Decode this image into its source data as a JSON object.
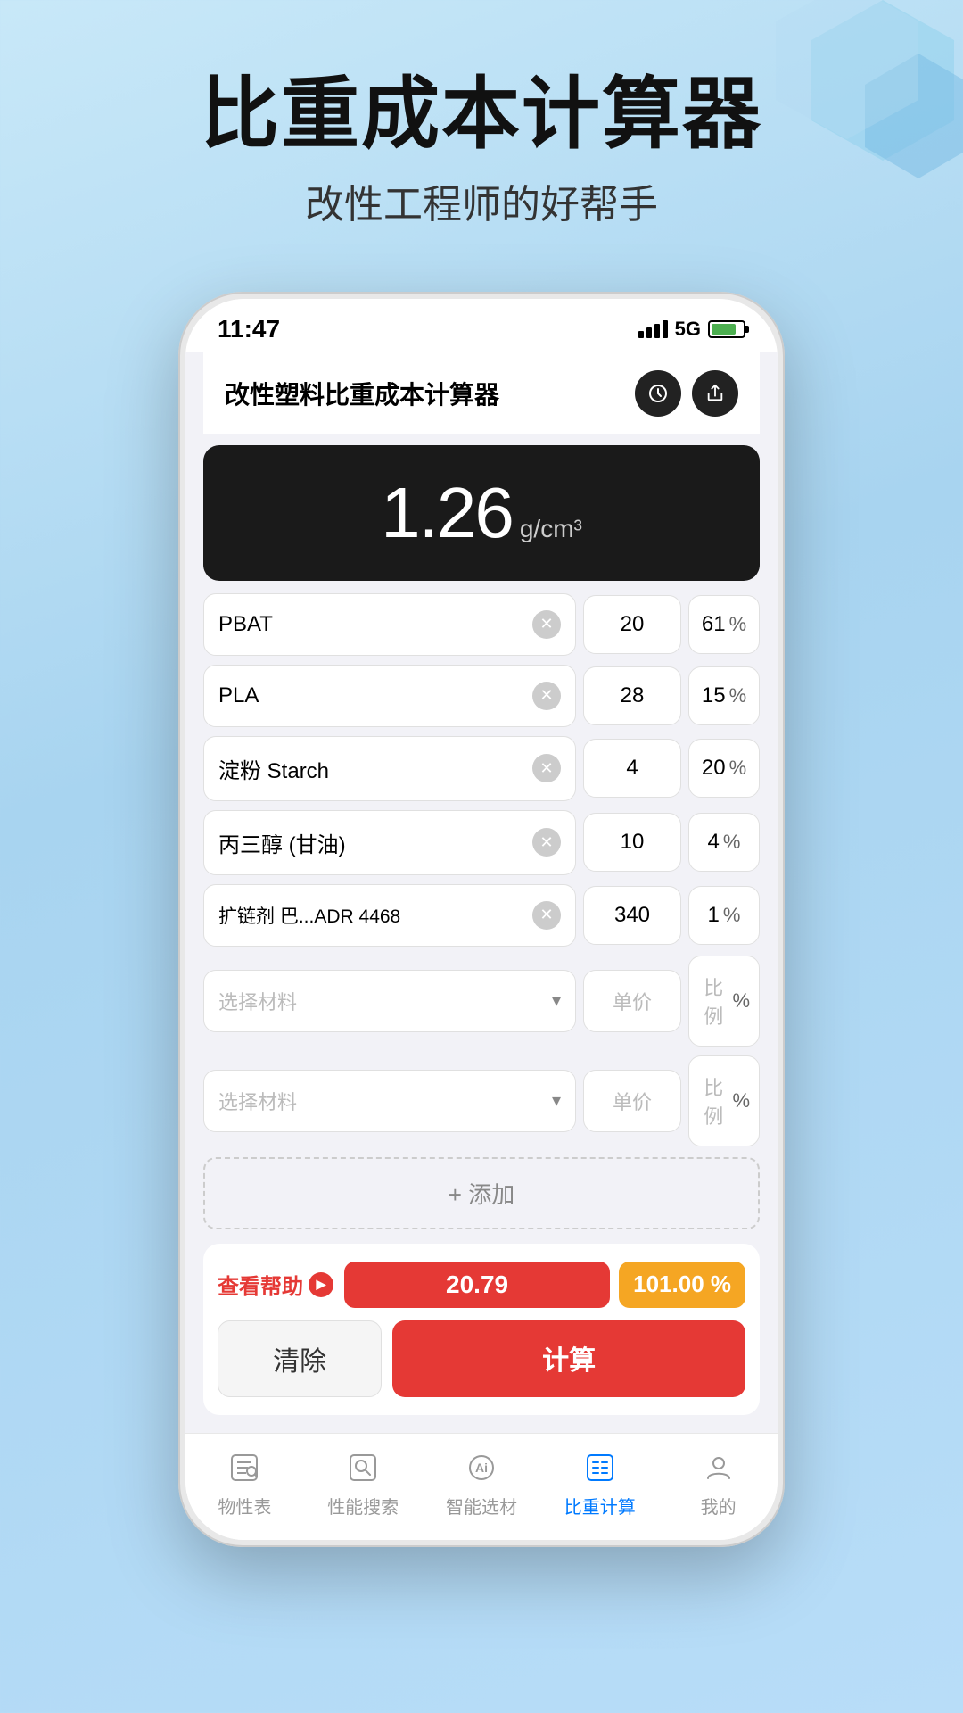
{
  "page": {
    "background_start": "#c8e8f8",
    "background_end": "#a8d4f0"
  },
  "header": {
    "main_title": "比重成本计算器",
    "sub_title": "改性工程师的好帮手"
  },
  "status_bar": {
    "time": "11:47",
    "signal_label": "5G"
  },
  "app": {
    "title": "改性塑料比重成本计算器",
    "result": {
      "value": "1.26",
      "unit": "g/cm³"
    },
    "materials": [
      {
        "name": "PBAT",
        "price": "20",
        "ratio": "61"
      },
      {
        "name": "PLA",
        "price": "28",
        "ratio": "15"
      },
      {
        "name": "淀粉 Starch",
        "price": "4",
        "ratio": "20"
      },
      {
        "name": "丙三醇 (甘油)",
        "price": "10",
        "ratio": "4"
      },
      {
        "name": "扩链剂 巴...ADR 4468",
        "price": "340",
        "ratio": "1"
      }
    ],
    "dropdowns": [
      {
        "name_placeholder": "选择材料",
        "price_placeholder": "单价",
        "ratio_placeholder": "比例"
      },
      {
        "name_placeholder": "选择材料",
        "price_placeholder": "单价",
        "ratio_placeholder": "比例"
      }
    ],
    "add_button_label": "+ 添加",
    "help_label": "查看帮助",
    "cost_value": "20.79",
    "ratio_value": "101.00 %",
    "clear_label": "清除",
    "calc_label": "计算"
  },
  "tabs": [
    {
      "id": "properties",
      "label": "物性表",
      "active": false
    },
    {
      "id": "search",
      "label": "性能搜索",
      "active": false
    },
    {
      "id": "ai",
      "label": "智能选材",
      "active": false
    },
    {
      "id": "calc",
      "label": "比重计算",
      "active": true
    },
    {
      "id": "mine",
      "label": "我的",
      "active": false
    }
  ]
}
